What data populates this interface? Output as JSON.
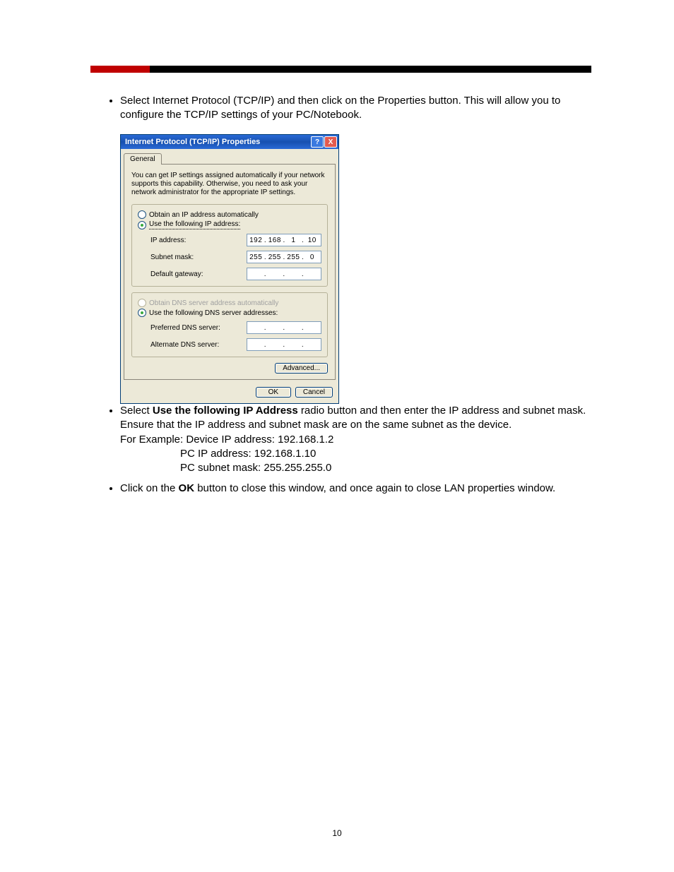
{
  "page_number": "10",
  "bullets": {
    "b1": "Select Internet Protocol (TCP/IP) and then click on the Properties button. This will allow you to configure the TCP/IP settings of your PC/Notebook.",
    "b2_pre": "Select ",
    "b2_bold": "Use the following IP Address",
    "b2_post": " radio button and then enter the IP address and subnet mask. Ensure that the IP address and subnet mask are on the same subnet as the device.",
    "b2_example_label": "For Example: Device IP address: 192.168.1.2",
    "b2_ex_pc_ip": "PC IP address: 192.168.1.10",
    "b2_ex_pc_mask": "PC subnet mask: 255.255.255.0",
    "b3_pre": "Click on the ",
    "b3_bold": "OK",
    "b3_post": " button to close this window, and once again to close LAN properties window."
  },
  "dialog": {
    "title": "Internet Protocol (TCP/IP) Properties",
    "tab": "General",
    "description": "You can get IP settings assigned automatically if your network supports this capability. Otherwise, you need to ask your network administrator for the appropriate IP settings.",
    "radio_auto_ip": "Obtain an IP address automatically",
    "radio_static_ip": "Use the following IP address:",
    "label_ip": "IP address:",
    "label_mask": "Subnet mask:",
    "label_gw": "Default gateway:",
    "ip": {
      "o1": "192",
      "o2": "168",
      "o3": "1",
      "o4": "10"
    },
    "mask": {
      "o1": "255",
      "o2": "255",
      "o3": "255",
      "o4": "0"
    },
    "gw": {
      "o1": "",
      "o2": "",
      "o3": "",
      "o4": ""
    },
    "radio_auto_dns": "Obtain DNS server address automatically",
    "radio_static_dns": "Use the following DNS server addresses:",
    "label_pref_dns": "Preferred DNS server:",
    "label_alt_dns": "Alternate DNS server:",
    "pref_dns": {
      "o1": "",
      "o2": "",
      "o3": "",
      "o4": ""
    },
    "alt_dns": {
      "o1": "",
      "o2": "",
      "o3": "",
      "o4": ""
    },
    "btn_advanced": "Advanced...",
    "btn_ok": "OK",
    "btn_cancel": "Cancel",
    "help_glyph": "?",
    "close_glyph": "X"
  }
}
